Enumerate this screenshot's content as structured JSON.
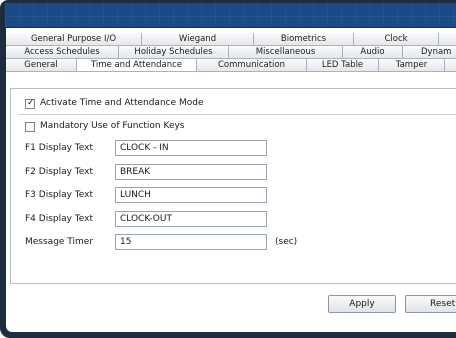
{
  "tabs": {
    "row1": [
      "General Purpose I/O",
      "Wiegand",
      "Biometrics",
      "Clock"
    ],
    "row2": [
      "Access Schedules",
      "Holiday Schedules",
      "Miscellaneous",
      "Audio",
      "Dynam"
    ],
    "row3": [
      "General",
      "Time and Attendance",
      "Communication",
      "LED Table",
      "Tamper"
    ],
    "active": "Time and Attendance"
  },
  "form": {
    "activate_label": "Activate Time and Attendance Mode",
    "activate_checked": true,
    "mandatory_label": "Mandatory Use of Function Keys",
    "mandatory_checked": false,
    "check_mark": "✓",
    "fields": [
      {
        "label": "F1 Display Text",
        "value": "CLOCK - IN"
      },
      {
        "label": "F2 Display Text",
        "value": "BREAK"
      },
      {
        "label": "F3 Display Text",
        "value": "LUNCH"
      },
      {
        "label": "F4 Display Text",
        "value": "CLOCK-OUT"
      },
      {
        "label": "Message Timer",
        "value": "15"
      }
    ],
    "timer_unit": "(sec)"
  },
  "buttons": {
    "apply": "Apply",
    "reset": "Reset"
  }
}
